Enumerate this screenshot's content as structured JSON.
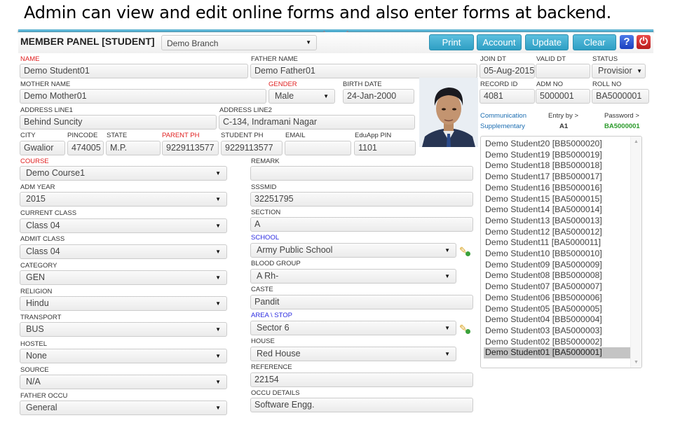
{
  "caption": "Admin can view and edit online forms and also enter forms at backend.",
  "header": {
    "title": "MEMBER PANEL [STUDENT]",
    "branch": "Demo Branch",
    "buttons": {
      "print": "Print",
      "account": "Account",
      "update": "Update",
      "clear": "Clear"
    },
    "help_icon": "?",
    "power_icon": "⏻"
  },
  "form": {
    "name": {
      "label": "NAME",
      "value": "Demo Student01"
    },
    "father_name": {
      "label": "FATHER NAME",
      "value": "Demo Father01"
    },
    "mother_name": {
      "label": "MOTHER NAME",
      "value": "Demo Mother01"
    },
    "gender": {
      "label": "GENDER",
      "value": "Male"
    },
    "birth_date": {
      "label": "BIRTH DATE",
      "value": "24-Jan-2000"
    },
    "address1": {
      "label": "ADDRESS LINE1",
      "value": "Behind Suncity"
    },
    "address2": {
      "label": "ADDRESS LINE2",
      "value": "C-134, Indramani Nagar"
    },
    "city": {
      "label": "CITY",
      "value": "Gwalior"
    },
    "pincode": {
      "label": "PINCODE",
      "value": "474005"
    },
    "state": {
      "label": "STATE",
      "value": "M.P."
    },
    "parent_ph": {
      "label": "PARENT PH",
      "value": "9229113577"
    },
    "student_ph": {
      "label": "STUDENT PH",
      "value": "9229113577"
    },
    "email": {
      "label": "EMAIL",
      "value": ""
    },
    "eduapp_pin": {
      "label": "EduApp PIN",
      "value": "1101"
    },
    "join_dt": {
      "label": "JOIN DT",
      "value": "05-Aug-2015"
    },
    "valid_dt": {
      "label": "VALID DT",
      "value": ""
    },
    "status": {
      "label": "STATUS",
      "value": "Provisior"
    },
    "record_id": {
      "label": "RECORD ID",
      "value": "4081"
    },
    "adm_no": {
      "label": "ADM NO",
      "value": "5000001"
    },
    "roll_no": {
      "label": "ROLL NO",
      "value": "BA5000001"
    },
    "course": {
      "label": "COURSE",
      "value": "Demo Course1"
    },
    "adm_year": {
      "label": "ADM YEAR",
      "value": "2015"
    },
    "current_class": {
      "label": "CURRENT CLASS",
      "value": "Class 04"
    },
    "admit_class": {
      "label": "ADMIT CLASS",
      "value": "Class 04"
    },
    "category": {
      "label": "CATEGORY",
      "value": "GEN"
    },
    "religion": {
      "label": "RELIGION",
      "value": "Hindu"
    },
    "transport": {
      "label": "TRANSPORT",
      "value": "BUS"
    },
    "hostel": {
      "label": "HOSTEL",
      "value": "None"
    },
    "source": {
      "label": "SOURCE",
      "value": "N/A"
    },
    "father_occu": {
      "label": "FATHER OCCU",
      "value": "General"
    },
    "remark": {
      "label": "REMARK",
      "value": ""
    },
    "sssmid": {
      "label": "SSSMID",
      "value": "32251795"
    },
    "section": {
      "label": "SECTION",
      "value": "A"
    },
    "school": {
      "label": "SCHOOL",
      "value": "Army Public School"
    },
    "blood_group": {
      "label": "BLOOD GROUP",
      "value": "A Rh-"
    },
    "caste": {
      "label": "CASTE",
      "value": "Pandit"
    },
    "area_stop": {
      "label": "AREA \\ STOP",
      "value": "Sector 6"
    },
    "house": {
      "label": "HOUSE",
      "value": "Red House"
    },
    "reference": {
      "label": "REFERENCE",
      "value": "22154"
    },
    "occu_details": {
      "label": "OCCU DETAILS",
      "value": "Software Engg."
    }
  },
  "info": {
    "communication": "Communication",
    "supplementary": "Supplementary",
    "entry_by_label": "Entry by >",
    "entry_by_value": "A1",
    "password_label": "Password >",
    "password_value": "BA5000001"
  },
  "student_list": {
    "selected_index": 19,
    "items": [
      "Demo Student20 [BB5000020]",
      "Demo Student19 [BB5000019]",
      "Demo Student18 [BB5000018]",
      "Demo Student17 [BB5000017]",
      "Demo Student16 [BB5000016]",
      "Demo Student15 [BA5000015]",
      "Demo Student14 [BA5000014]",
      "Demo Student13 [BA5000013]",
      "Demo Student12 [BA5000012]",
      "Demo Student11 [BA5000011]",
      "Demo Student10 [BB5000010]",
      "Demo Student09 [BA5000009]",
      "Demo Student08 [BB5000008]",
      "Demo Student07 [BA5000007]",
      "Demo Student06 [BB5000006]",
      "Demo Student05 [BA5000005]",
      "Demo Student04 [BB5000004]",
      "Demo Student03 [BA5000003]",
      "Demo Student02 [BB5000002]",
      "Demo Student01 [BA5000001]"
    ]
  },
  "colors": {
    "button_blue": "#2f9fc4",
    "required_label": "#e02020",
    "link_label": "#2a2ae0",
    "password_green": "#2a9a2a"
  }
}
